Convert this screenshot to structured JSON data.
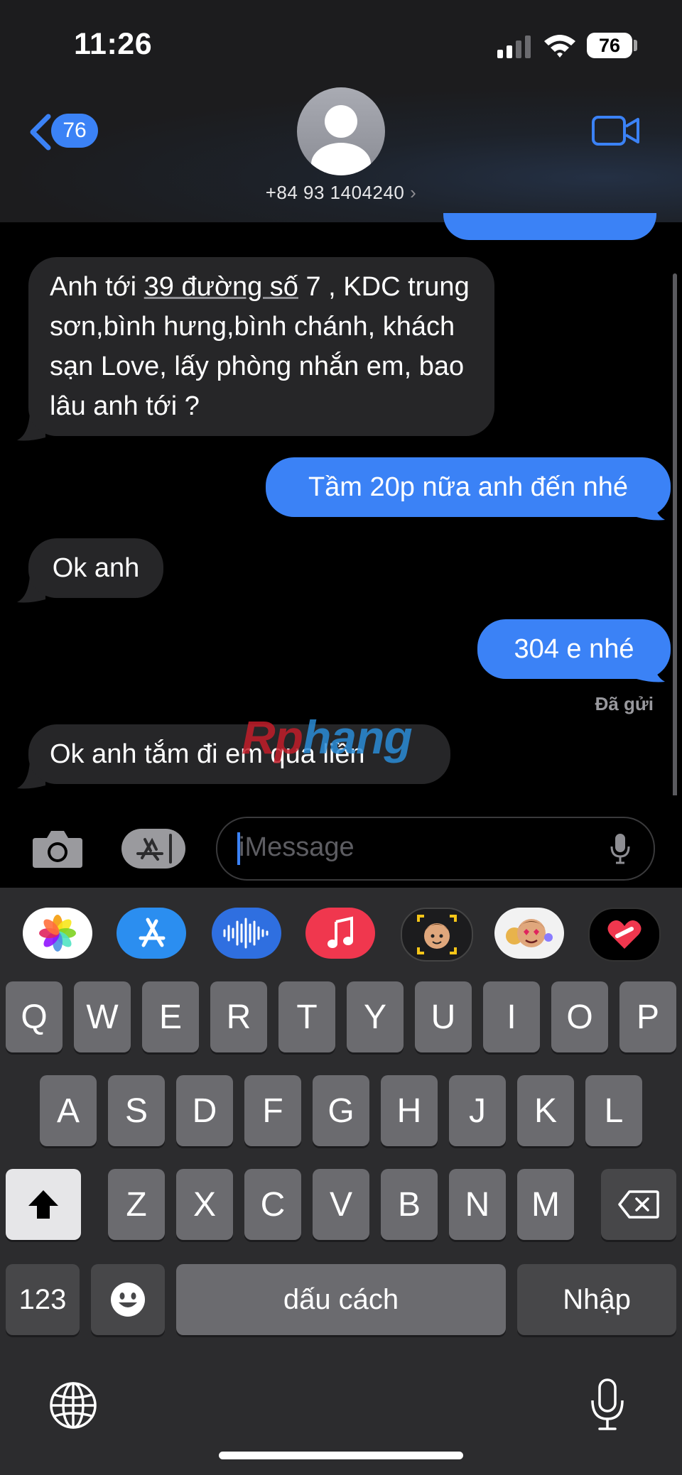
{
  "status": {
    "time": "11:26",
    "battery": "76"
  },
  "header": {
    "back_count": "76",
    "contact": "+84 93 1404240",
    "chevron": "›"
  },
  "messages": [
    {
      "from": "them",
      "text": "Anh tới 39 đường số 7 , KDC trung sơn,bình hưng,bình chánh, khách sạn Love, lấy phòng nhắn em, bao lâu anh tới ?"
    },
    {
      "from": "me",
      "text": "Tầm 20p nữa anh đến nhé"
    },
    {
      "from": "them",
      "text": "Ok anh"
    },
    {
      "from": "me",
      "text": "304 e nhé"
    },
    {
      "from": "them",
      "text": "Ok anh tắm đi em qua liền"
    }
  ],
  "message_parts": {
    "m1_pre": "Anh tới ",
    "m1_link": "39 đường số",
    "m1_post": " 7 , KDC trung sơn,bình hưng,bình chánh, khách sạn Love, lấy phòng nhắn em, bao lâu anh tới ?"
  },
  "delivery_status": "Đã gửi",
  "watermark": {
    "part1": "Rp",
    "part2": "hang"
  },
  "composer": {
    "placeholder": "iMessage"
  },
  "app_strip": [
    "photos-icon",
    "app-store-icon",
    "audio-message-icon",
    "music-icon",
    "memoji-icon",
    "memoji-stickers-icon",
    "digital-touch-icon"
  ],
  "keyboard": {
    "row1": [
      "Q",
      "W",
      "E",
      "R",
      "T",
      "Y",
      "U",
      "I",
      "O",
      "P"
    ],
    "row2": [
      "A",
      "S",
      "D",
      "F",
      "G",
      "H",
      "J",
      "K",
      "L"
    ],
    "row3": [
      "Z",
      "X",
      "C",
      "V",
      "B",
      "N",
      "M"
    ],
    "numbers": "123",
    "space": "dấu cách",
    "return": "Nhập"
  },
  "colors": {
    "accent": "#3b82f6",
    "incoming": "#262628",
    "keyboard": "#2c2c2e",
    "key": "#6b6b6f"
  }
}
